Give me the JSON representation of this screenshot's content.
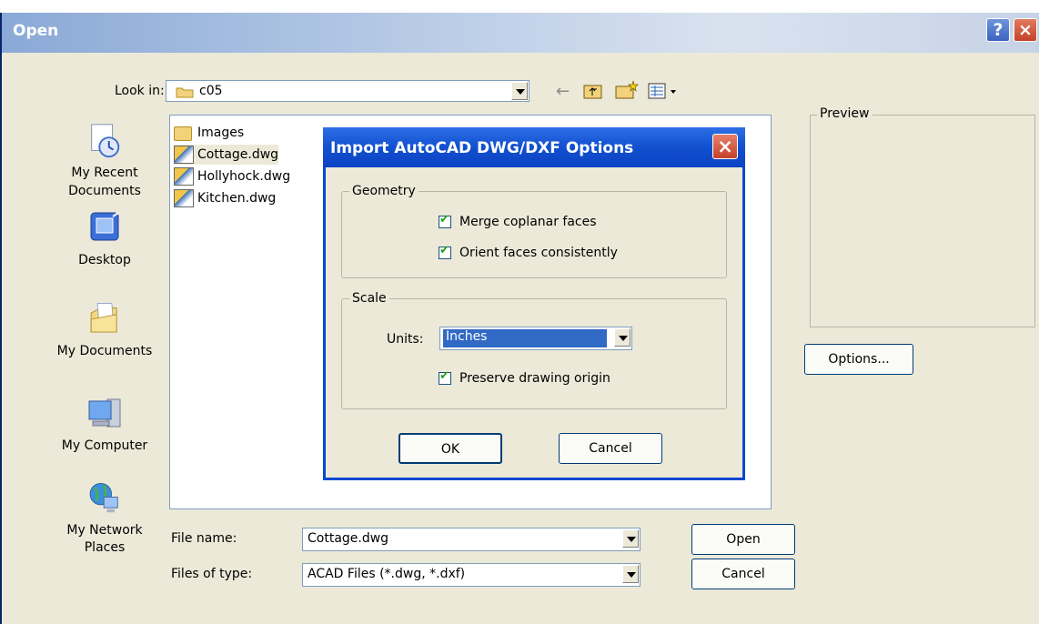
{
  "window": {
    "title": "Open",
    "help_glyph": "?",
    "close_glyph": "×"
  },
  "toolbar": {
    "look_in_label": "Look in:",
    "look_in_value": "c05",
    "back_glyph": "←"
  },
  "places": [
    {
      "label": "My Recent Documents",
      "icon": "recent-documents-icon"
    },
    {
      "label": "Desktop",
      "icon": "desktop-icon"
    },
    {
      "label": "My Documents",
      "icon": "my-documents-icon"
    },
    {
      "label": "My Computer",
      "icon": "my-computer-icon"
    },
    {
      "label": "My Network Places",
      "icon": "network-places-icon"
    }
  ],
  "files": [
    {
      "name": "Images",
      "type": "folder"
    },
    {
      "name": "Cottage.dwg",
      "type": "dwg",
      "selected": true
    },
    {
      "name": "Hollyhock.dwg",
      "type": "dwg"
    },
    {
      "name": "Kitchen.dwg",
      "type": "dwg"
    }
  ],
  "preview": {
    "label": "Preview"
  },
  "options_button": "Options...",
  "file_name": {
    "label": "File name:",
    "value": "Cottage.dwg"
  },
  "file_type": {
    "label": "Files of type:",
    "value": "ACAD Files (*.dwg, *.dxf)"
  },
  "buttons": {
    "open": "Open",
    "cancel": "Cancel"
  },
  "import_dialog": {
    "title": "Import AutoCAD DWG/DXF Options",
    "close_glyph": "×",
    "geometry": {
      "label": "Geometry",
      "merge_coplanar": {
        "label": "Merge coplanar faces",
        "checked": true
      },
      "orient_faces": {
        "label": "Orient faces consistently",
        "checked": true
      }
    },
    "scale": {
      "label": "Scale",
      "units_label": "Units:",
      "units_value": "Inches",
      "preserve_origin": {
        "label": "Preserve drawing origin",
        "checked": true
      }
    },
    "ok_label": "OK",
    "cancel_label": "Cancel"
  },
  "colors": {
    "dialog_bg": "#ece9d8",
    "title_blue": "#1250cf",
    "selection_blue": "#316ac5"
  }
}
